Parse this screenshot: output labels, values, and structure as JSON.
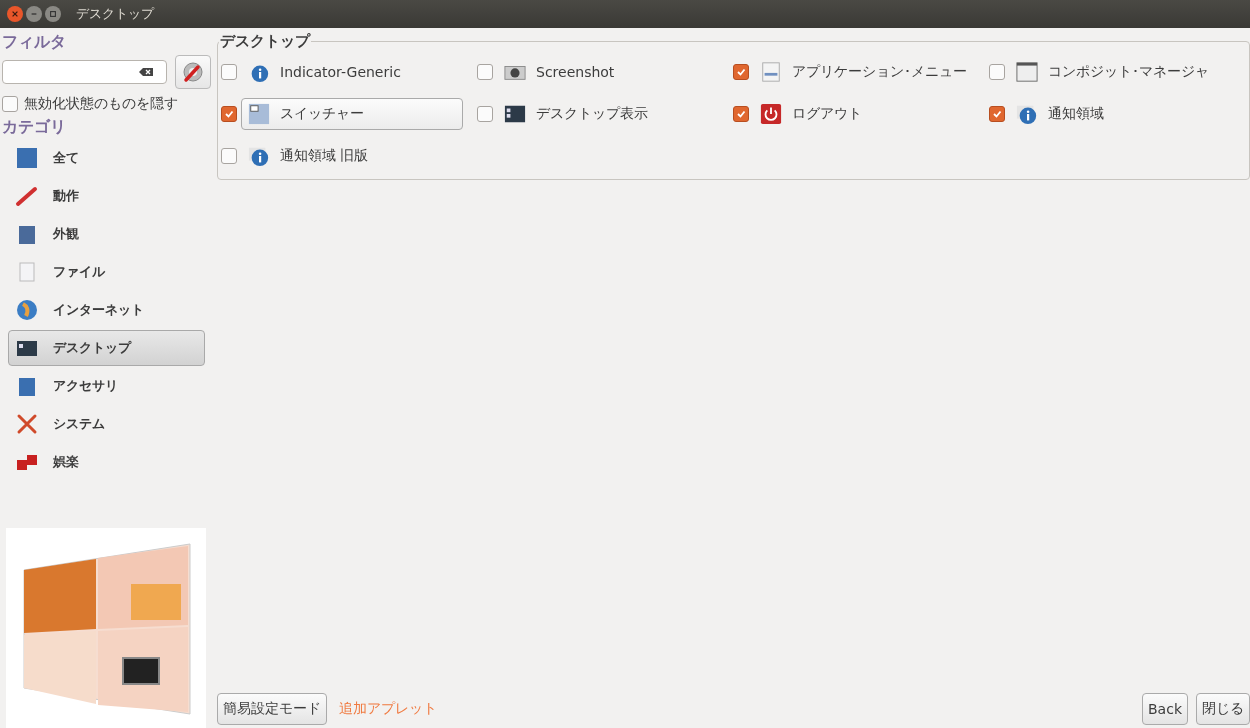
{
  "window": {
    "title": "デスクトップ"
  },
  "sidebar": {
    "filter_heading": "フィルタ",
    "hide_disabled": {
      "label": "無効化状態のものを隠す",
      "checked": false
    },
    "category_heading": "カテゴリ",
    "categories": [
      {
        "label": "全て",
        "selected": false
      },
      {
        "label": "動作",
        "selected": false
      },
      {
        "label": "外観",
        "selected": false
      },
      {
        "label": "ファイル",
        "selected": false
      },
      {
        "label": "インターネット",
        "selected": false
      },
      {
        "label": "デスクトップ",
        "selected": true
      },
      {
        "label": "アクセサリ",
        "selected": false
      },
      {
        "label": "システム",
        "selected": false
      },
      {
        "label": "娯楽",
        "selected": false
      }
    ]
  },
  "group": {
    "title": "デスクトップ",
    "plugins": [
      {
        "label": "Indicator-Generic",
        "checked": false,
        "selected": false
      },
      {
        "label": "Screenshot",
        "checked": false,
        "selected": false
      },
      {
        "label": "アプリケーション･メニュー",
        "checked": true,
        "selected": false
      },
      {
        "label": "コンポジット･マネージャ",
        "checked": false,
        "selected": false
      },
      {
        "label": "スイッチャー",
        "checked": true,
        "selected": true
      },
      {
        "label": "デスクトップ表示",
        "checked": false,
        "selected": false
      },
      {
        "label": "ログアウト",
        "checked": true,
        "selected": false
      },
      {
        "label": "通知領域",
        "checked": true,
        "selected": false
      },
      {
        "label": "通知領域 旧版",
        "checked": false,
        "selected": false
      }
    ]
  },
  "footer": {
    "simple_mode_button": "簡易設定モード",
    "add_applets_link": "追加アプレット",
    "back_button": "Back",
    "close_button": "閉じる"
  }
}
